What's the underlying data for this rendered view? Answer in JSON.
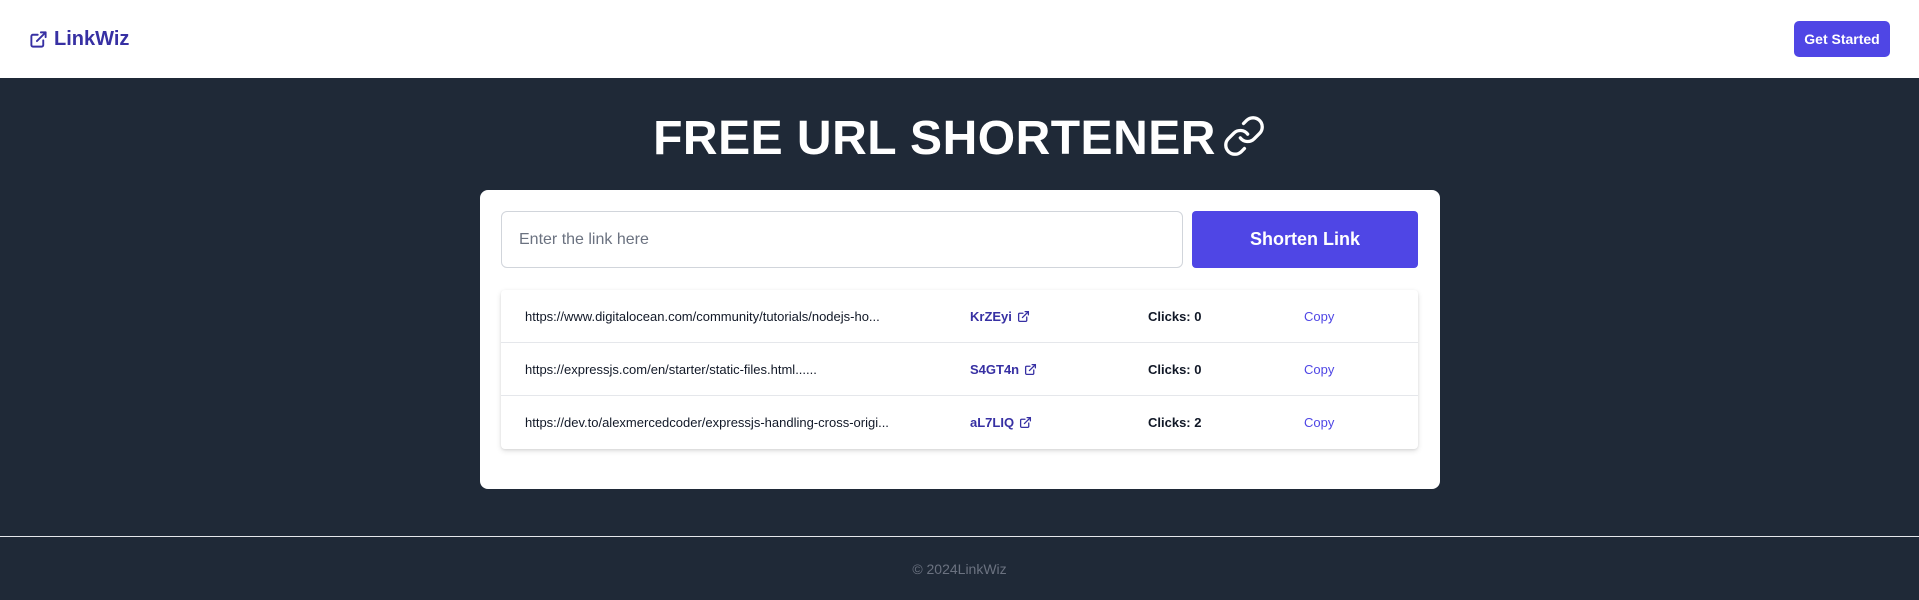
{
  "header": {
    "brand": "LinkWiz",
    "get_started": "Get Started"
  },
  "hero": {
    "title": "FREE URL SHORTENER"
  },
  "form": {
    "placeholder": "Enter the link here",
    "submit_label": "Shorten Link"
  },
  "links": [
    {
      "original": "https://www.digitalocean.com/community/tutorials/nodejs-ho...",
      "short": "KrZEyi",
      "clicks": "Clicks: 0",
      "copy": "Copy"
    },
    {
      "original": "https://expressjs.com/en/starter/static-files.html......",
      "short": "S4GT4n",
      "clicks": "Clicks: 0",
      "copy": "Copy"
    },
    {
      "original": "https://dev.to/alexmercedcoder/expressjs-handling-cross-origi...",
      "short": "aL7LIQ",
      "clicks": "Clicks: 2",
      "copy": "Copy"
    }
  ],
  "footer": {
    "copyright": "© 2024LinkWiz"
  },
  "colors": {
    "primary": "#4f46e5",
    "brand_text": "#3730a3",
    "background": "#1f2937"
  },
  "icons": {
    "brand": "external-link-icon",
    "hero": "link-icon",
    "row": "external-link-icon"
  }
}
